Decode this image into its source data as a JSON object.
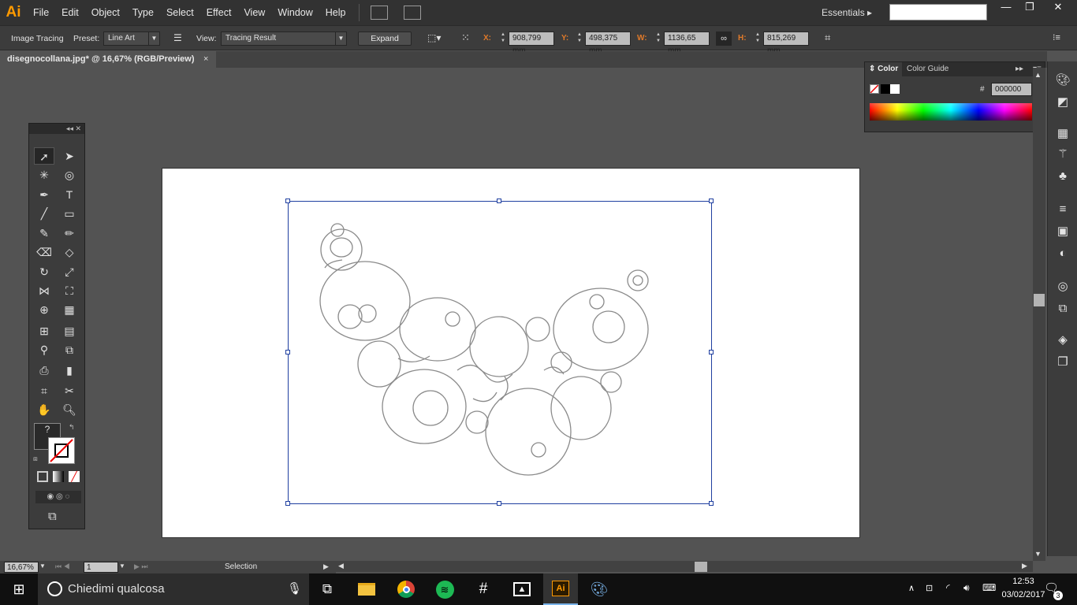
{
  "app": {
    "logo": "Ai"
  },
  "menu": [
    "File",
    "Edit",
    "Object",
    "Type",
    "Select",
    "Effect",
    "View",
    "Window",
    "Help"
  ],
  "workspace": {
    "label": "Essentials ▸",
    "search_placeholder": ""
  },
  "control_bar": {
    "image_tracing": "Image Tracing",
    "preset_label": "Preset:",
    "preset_value": "Line Art",
    "view_label": "View:",
    "view_value": "Tracing Result",
    "expand": "Expand",
    "x_label": "X:",
    "x_value": "908,799 mm",
    "y_label": "Y:",
    "y_value": "498,375 mm",
    "w_label": "W:",
    "w_value": "1136,65 mm",
    "h_label": "H:",
    "h_value": "815,269 mm"
  },
  "document_tab": {
    "title": "disegnocollana.jpg* @ 16,67% (RGB/Preview)",
    "close": "×"
  },
  "color_panel": {
    "tab_color": "Color",
    "tab_guide": "Color Guide",
    "hex_label": "#",
    "hex_value": "000000"
  },
  "status_bar": {
    "zoom": "16,67%",
    "page": "1",
    "tool": "Selection"
  },
  "taskbar": {
    "search_placeholder": "Chiedimi qualcosa",
    "time": "12:53",
    "date": "03/02/2017",
    "notification_count": "3"
  },
  "colors": {
    "accent_orange": "#ff9a00",
    "selection_blue": "#1f3fa0",
    "taskbar_active": "#7ab4ea"
  }
}
